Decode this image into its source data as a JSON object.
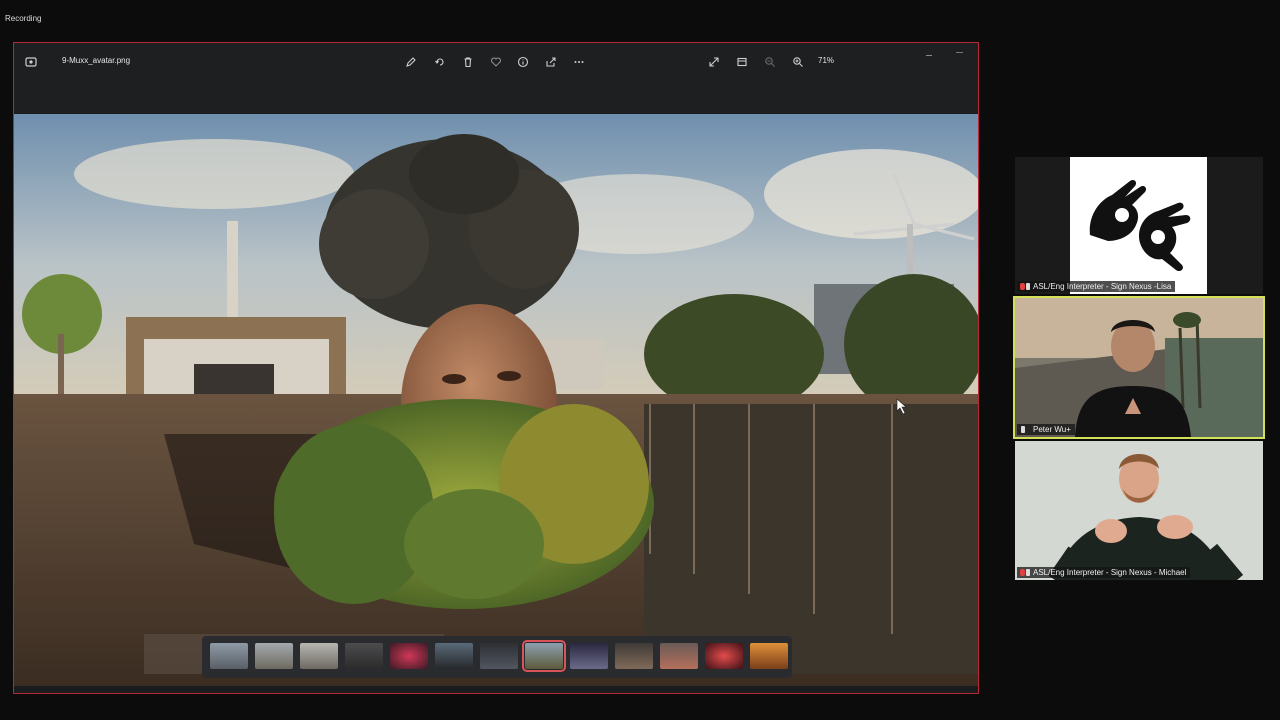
{
  "recording": {
    "label": "Recording"
  },
  "viewer": {
    "filename": "9-Muxx_avatar.png",
    "zoom": "71%",
    "toolbar_icons": [
      "edit-icon",
      "rotate-icon",
      "delete-icon",
      "favorite-icon",
      "info-icon",
      "share-icon",
      "more-icon",
      "expand-icon",
      "slideshow-icon",
      "zoom-out-icon",
      "zoom-in-icon"
    ]
  },
  "filmstrip": {
    "count": 13,
    "selected_index": 7
  },
  "participants": [
    {
      "name": "ASL/Eng Interpreter - Sign Nexus -Lisa",
      "role": "asl-logo"
    },
    {
      "name": "Peter Wu+",
      "role": "active-speaker"
    },
    {
      "name": "ASL/Eng Interpreter - Sign Nexus - Michael",
      "role": "interpreter"
    }
  ],
  "colors": {
    "share_border": "#b8263a",
    "speaker_highlight": "#d3e05a",
    "selected_thumb": "#d8545a"
  }
}
